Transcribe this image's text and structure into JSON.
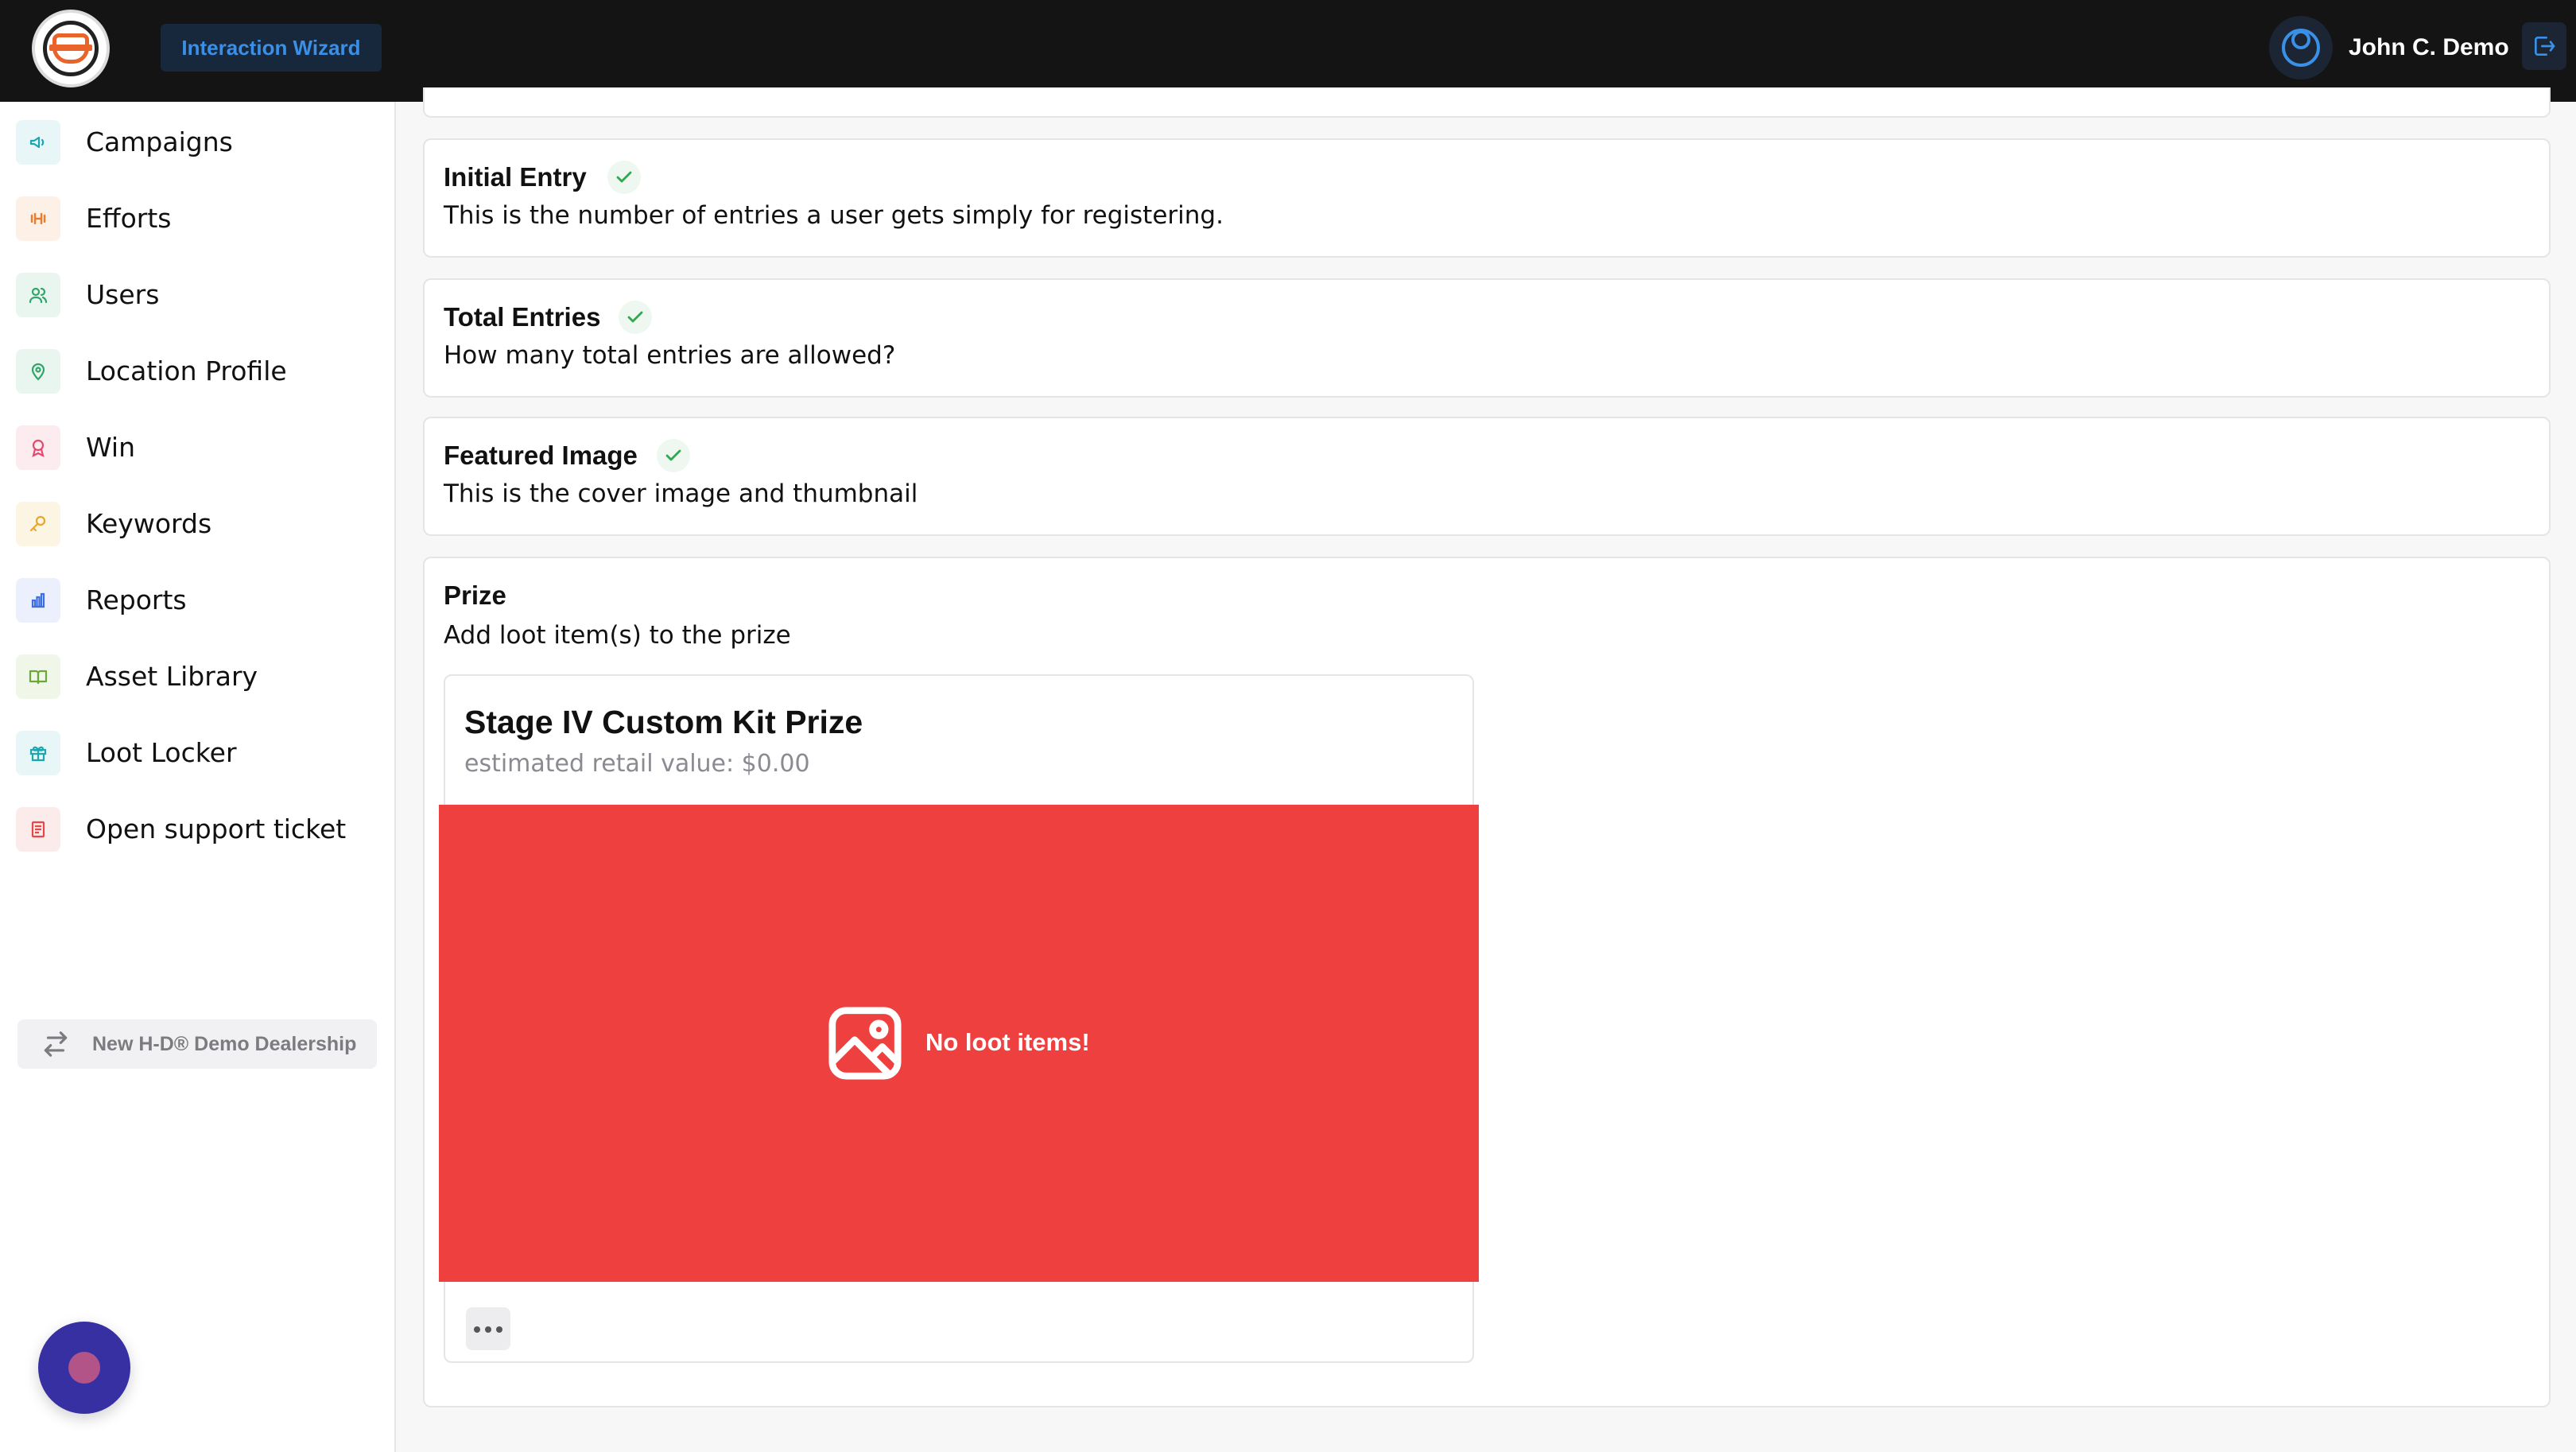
{
  "header": {
    "logo": "dealership-logo",
    "wizard_label": "Interaction Wizard",
    "user_name": "John C. Demo",
    "icons": {
      "user": "user-circle-icon",
      "logout": "logout-icon"
    },
    "accent_color": "#3a8fe6"
  },
  "sidebar": {
    "items": [
      {
        "label": "Campaigns",
        "icon": "megaphone-icon",
        "color": "#1aa7b0"
      },
      {
        "label": "Efforts",
        "icon": "dumbbell-icon",
        "color": "#f07a2a"
      },
      {
        "label": "Users",
        "icon": "users-icon",
        "color": "#2fa56b"
      },
      {
        "label": "Location Profile",
        "icon": "map-pin-icon",
        "color": "#2fa56b"
      },
      {
        "label": "Win",
        "icon": "award-icon",
        "color": "#e24a6e"
      },
      {
        "label": "Keywords",
        "icon": "key-icon",
        "color": "#e6a72a"
      },
      {
        "label": "Reports",
        "icon": "bar-chart-icon",
        "color": "#3d6fe0"
      },
      {
        "label": "Asset Library",
        "icon": "book-open-icon",
        "color": "#6aa83a"
      },
      {
        "label": "Loot Locker",
        "icon": "gift-icon",
        "color": "#1aa7b0"
      },
      {
        "label": "Open support ticket",
        "icon": "ticket-icon",
        "color": "#e24a4a"
      }
    ],
    "dealer_switch_label": "New H-D® Demo Dealership"
  },
  "sections": [
    {
      "title": "Initial Entry",
      "description": "This is the number of entries a user gets simply for registering.",
      "complete": true
    },
    {
      "title": "Total Entries",
      "description": "How many total entries are allowed?",
      "complete": true
    },
    {
      "title": "Featured Image",
      "description": "This is the cover image and thumbnail",
      "complete": true
    }
  ],
  "prize": {
    "title": "Prize",
    "description": "Add loot item(s) to the prize",
    "card_title": "Stage IV Custom Kit Prize",
    "card_subtitle": "estimated retail value: $0.00",
    "empty_message": "No loot items!",
    "placeholder_color": "#ef4040",
    "empty_icon": "image-icon",
    "more_icon": "more-horizontal-icon"
  },
  "chat_widget_icon": "chat-bubble-icon"
}
